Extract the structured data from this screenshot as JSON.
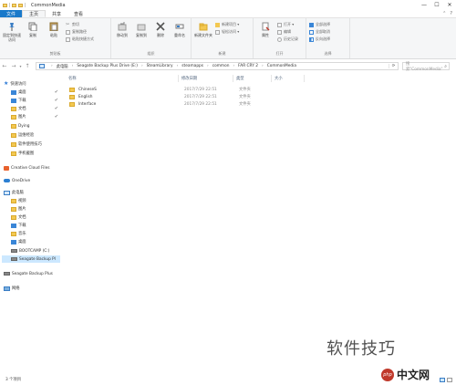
{
  "window": {
    "title": "CommonMedia",
    "minimize": "—",
    "maximize": "☐",
    "close": "✕"
  },
  "ribbon": {
    "tabs": [
      {
        "label": "文件"
      },
      {
        "label": "主页"
      },
      {
        "label": "共享"
      },
      {
        "label": "查看"
      }
    ],
    "help": "?",
    "expand": "⌃",
    "groups": {
      "clipboard": {
        "label": "剪贴板",
        "pin": "固定到快速访问",
        "copy": "复制",
        "paste": "粘贴",
        "cut": "剪切",
        "copy_path": "复制路径",
        "paste_shortcut": "粘贴快捷方式"
      },
      "organize": {
        "label": "组织",
        "move_to": "移动到",
        "copy_to": "复制到",
        "delete": "删除",
        "rename": "重命名"
      },
      "new": {
        "label": "新建",
        "new_folder": "新建文件夹",
        "new_item": "新建项目 ▾",
        "easy_access": "轻松访问 ▾"
      },
      "open": {
        "label": "打开",
        "properties": "属性",
        "open": "打开 ▾",
        "edit": "编辑",
        "history": "历史记录"
      },
      "select": {
        "label": "选择",
        "select_all": "全部选择",
        "select_none": "全部取消",
        "invert": "反向选择"
      }
    }
  },
  "addressbar": {
    "back": "←",
    "forward": "→",
    "recent": "▾",
    "up": "↑",
    "crumbs": [
      "此电脑",
      "Seagate Backup Plus Drive (E:)",
      "SteamLibrary",
      "steamapps",
      "common",
      "FAR CRY 2",
      "CommonMedia"
    ],
    "refresh": "⟳",
    "search_placeholder": "搜索\"CommonMedia\""
  },
  "nav": {
    "items": [
      {
        "label": "快速访问",
        "icon": "star-icon",
        "pinned": false
      },
      {
        "label": "桌面",
        "icon": "desktop-icon",
        "pinned": true
      },
      {
        "label": "下载",
        "icon": "download-icon",
        "pinned": true
      },
      {
        "label": "文档",
        "icon": "documents-icon",
        "pinned": true
      },
      {
        "label": "图片",
        "icon": "pictures-icon",
        "pinned": true
      },
      {
        "label": "Dying",
        "icon": "folder-icon",
        "pinned": false
      },
      {
        "label": "运维经验",
        "icon": "folder-icon",
        "pinned": false
      },
      {
        "label": "软件使用技巧",
        "icon": "folder-icon",
        "pinned": false
      },
      {
        "label": "手机截图",
        "icon": "folder-icon",
        "pinned": false
      },
      {
        "label": "Creative Cloud Files",
        "icon": "creative-cloud-icon",
        "pinned": false
      },
      {
        "label": "OneDrive",
        "icon": "onedrive-icon",
        "pinned": false
      },
      {
        "label": "此电脑",
        "icon": "this-pc-icon",
        "pinned": false
      },
      {
        "label": "视频",
        "icon": "videos-icon",
        "pinned": false
      },
      {
        "label": "图片",
        "icon": "pictures-icon",
        "pinned": false
      },
      {
        "label": "文档",
        "icon": "documents-icon",
        "pinned": false
      },
      {
        "label": "下载",
        "icon": "download-icon",
        "pinned": false
      },
      {
        "label": "音乐",
        "icon": "music-icon",
        "pinned": false
      },
      {
        "label": "桌面",
        "icon": "desktop-icon",
        "pinned": false
      },
      {
        "label": "BOOTCAMP (C:)",
        "icon": "drive-icon",
        "pinned": false
      },
      {
        "label": "Seagate Backup Pl",
        "icon": "drive-icon",
        "pinned": false
      },
      {
        "label": "Seagate Backup Plus",
        "icon": "drive-icon",
        "pinned": false
      },
      {
        "label": "网络",
        "icon": "network-icon",
        "pinned": false
      }
    ],
    "pin_glyph": "✔",
    "expand_glyph": "›"
  },
  "content": {
    "columns": [
      "名称",
      "修改日期",
      "类型",
      "大小"
    ],
    "rows": [
      {
        "name": "ChineseS",
        "modified": "2017/7/29 22:51",
        "type": "文件夹",
        "size": ""
      },
      {
        "name": "English",
        "modified": "2017/7/29 22:51",
        "type": "文件夹",
        "size": ""
      },
      {
        "name": "Interface",
        "modified": "2017/7/29 22:51",
        "type": "文件夹",
        "size": ""
      }
    ]
  },
  "statusbar": {
    "count": "3 个项目"
  },
  "watermark": {
    "text": "软件技巧",
    "site": "中文网",
    "logo": "php"
  },
  "colors": {
    "file_tab": "#1979ca",
    "selected": "#cce8ff",
    "folder": "#f3c851"
  }
}
